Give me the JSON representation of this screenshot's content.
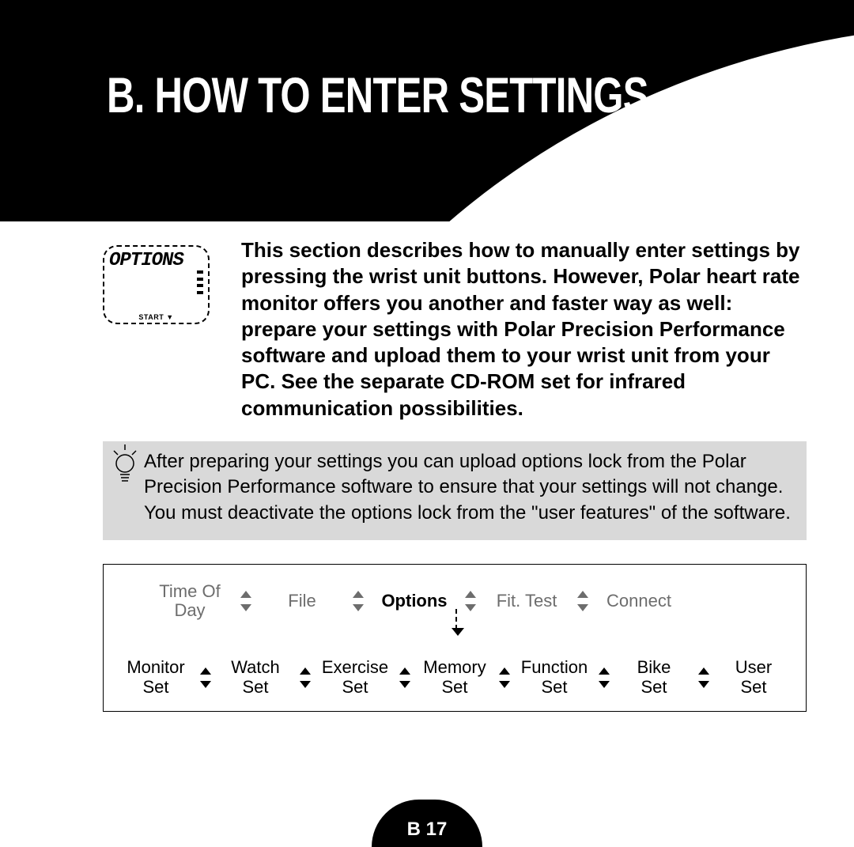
{
  "page": {
    "title": "B. HOW TO ENTER SETTINGS",
    "footer": "B 17"
  },
  "watch": {
    "display": "OPTIONS",
    "start": "START ▼"
  },
  "intro": "This section describes how to manually enter settings by pressing the wrist unit buttons. However, Polar heart rate monitor offers you another and faster way as well: prepare your settings with Polar Precision Performance software and upload them to your wrist unit from your PC. See the separate CD-ROM set for infrared communication possibilities.",
  "tip": "After preparing your settings you can upload options lock from the Polar Precision Performance software to ensure that your settings will not change. You must deactivate the options lock from the \"user features\" of the software.",
  "nav": {
    "top": [
      {
        "line1": "Time Of",
        "line2": "Day",
        "bold": false
      },
      {
        "line1": "File",
        "line2": "",
        "bold": false
      },
      {
        "line1": "Options",
        "line2": "",
        "bold": true
      },
      {
        "line1": "Fit. Test",
        "line2": "",
        "bold": false
      },
      {
        "line1": "Connect",
        "line2": "",
        "bold": false
      }
    ],
    "bottom": [
      {
        "line1": "Monitor",
        "line2": "Set"
      },
      {
        "line1": "Watch",
        "line2": "Set"
      },
      {
        "line1": "Exercise",
        "line2": "Set"
      },
      {
        "line1": "Memory",
        "line2": "Set"
      },
      {
        "line1": "Function",
        "line2": "Set"
      },
      {
        "line1": "Bike",
        "line2": "Set"
      },
      {
        "line1": "User",
        "line2": "Set"
      }
    ]
  }
}
